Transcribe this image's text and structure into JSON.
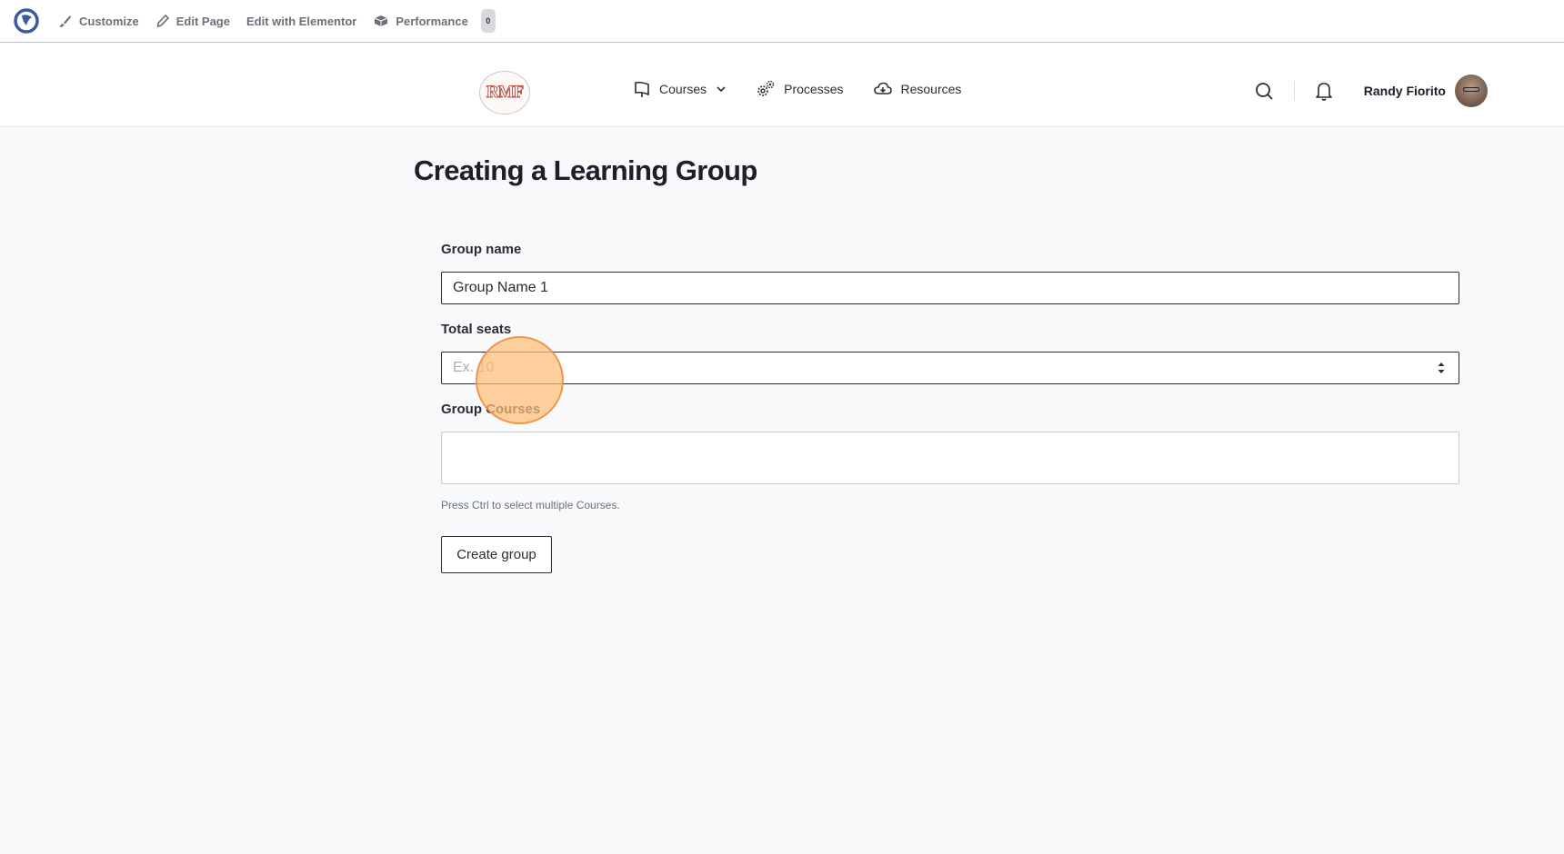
{
  "adminbar": {
    "items": [
      {
        "label": "Customize",
        "icon": "brush-icon"
      },
      {
        "label": "Edit Page",
        "icon": "pencil-icon"
      },
      {
        "label": "Edit with Elementor",
        "icon": ""
      },
      {
        "label": "Performance",
        "icon": "box-icon"
      }
    ],
    "performance_badge": "0"
  },
  "header": {
    "logo_text": "RMF",
    "nav": [
      {
        "label": "Courses",
        "icon": "book-icon",
        "has_dropdown": true
      },
      {
        "label": "Processes",
        "icon": "gears-icon",
        "has_dropdown": false
      },
      {
        "label": "Resources",
        "icon": "cloud-download-icon",
        "has_dropdown": false
      }
    ],
    "user_name": "Randy Fiorito"
  },
  "page": {
    "title": "Creating a Learning Group"
  },
  "form": {
    "group_name_label": "Group name",
    "group_name_value": "Group Name 1",
    "total_seats_label": "Total seats",
    "total_seats_placeholder": "Ex. 10",
    "group_courses_label": "Group Courses",
    "group_courses_help": "Press Ctrl to select multiple Courses.",
    "submit_label": "Create group"
  },
  "colors": {
    "accent_blue": "#3a5ba0",
    "logo_red": "#c0524a",
    "click_indicator": "#ffbe78"
  }
}
